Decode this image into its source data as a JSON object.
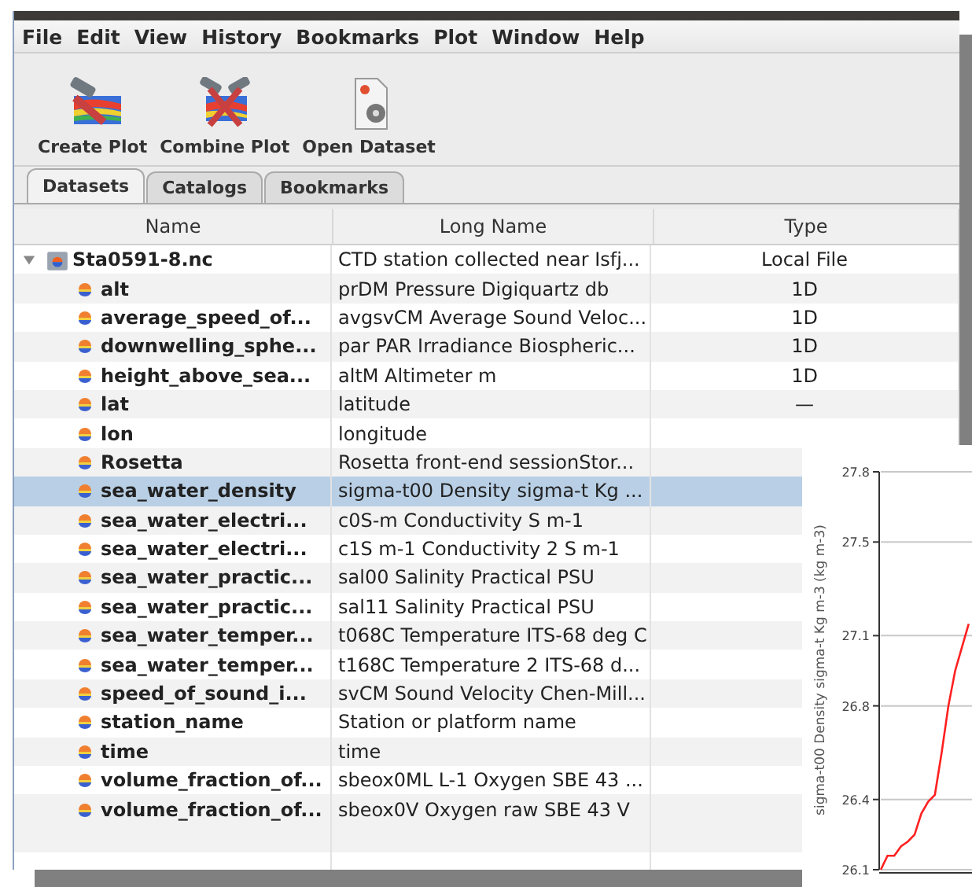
{
  "menu": [
    "File",
    "Edit",
    "View",
    "History",
    "Bookmarks",
    "Plot",
    "Window",
    "Help"
  ],
  "toolbar": [
    {
      "label": "Create Plot",
      "kind": "create"
    },
    {
      "label": "Combine Plot",
      "kind": "combine"
    },
    {
      "label": "Open Dataset",
      "kind": "open"
    }
  ],
  "tabs": [
    {
      "label": "Datasets",
      "selected": true
    },
    {
      "label": "Catalogs",
      "selected": false
    },
    {
      "label": "Bookmarks",
      "selected": false
    }
  ],
  "table": {
    "columns": [
      "Name",
      "Long Name",
      "Type"
    ],
    "rows": [
      {
        "name": "Sta0591-8.nc",
        "long_name": "CTD station collected near Isfj...",
        "type": "Local File",
        "expanded": true,
        "children": [
          {
            "name": "alt",
            "long_name": "prDM Pressure Digiquartz db",
            "type": "1D",
            "selected": false
          },
          {
            "name": "average_speed_of...",
            "long_name": "avgsvCM Average Sound Veloc...",
            "type": "1D",
            "selected": false
          },
          {
            "name": "downwelling_sphe...",
            "long_name": "par PAR Irradiance Biospheric...",
            "type": "1D",
            "selected": false
          },
          {
            "name": "height_above_sea...",
            "long_name": "altM Altimeter m",
            "type": "1D",
            "selected": false
          },
          {
            "name": "lat",
            "long_name": "latitude",
            "type": "—",
            "selected": false
          },
          {
            "name": "lon",
            "long_name": "longitude",
            "selected": false
          },
          {
            "name": "Rosetta",
            "long_name": "Rosetta front-end sessionStor...",
            "selected": false
          },
          {
            "name": "sea_water_density",
            "long_name": "sigma-t00 Density sigma-t Kg ...",
            "selected": true
          },
          {
            "name": "sea_water_electri...",
            "long_name": "c0S-m Conductivity S m-1",
            "selected": false
          },
          {
            "name": "sea_water_electri...",
            "long_name": "c1S m-1 Conductivity 2  S m-1",
            "selected": false
          },
          {
            "name": "sea_water_practic...",
            "long_name": "sal00 Salinity  Practical PSU",
            "selected": false
          },
          {
            "name": "sea_water_practic...",
            "long_name": "sal11 Salinity  Practical PSU",
            "selected": false
          },
          {
            "name": "sea_water_temper...",
            "long_name": "t068C Temperature ITS-68 deg C",
            "selected": false
          },
          {
            "name": "sea_water_temper...",
            "long_name": "t168C Temperature 2 ITS-68 d...",
            "selected": false
          },
          {
            "name": "speed_of_sound_i...",
            "long_name": "svCM Sound Velocity Chen-Mill...",
            "selected": false
          },
          {
            "name": "station_name",
            "long_name": "Station or platform name",
            "selected": false
          },
          {
            "name": "time",
            "long_name": "time",
            "selected": false
          },
          {
            "name": "volume_fraction_of...",
            "long_name": "sbeox0ML L-1 Oxygen SBE 43 ...",
            "selected": false
          },
          {
            "name": "volume_fraction_of...",
            "long_name": "sbeox0V Oxygen raw SBE 43 V",
            "selected": false
          }
        ]
      }
    ]
  },
  "plot_window": {
    "chart_data": {
      "type": "line",
      "grid": true,
      "ylabel": "sigma-t00 Density sigma-t Kg m-3 (kg m-3)",
      "ylim": [
        26.1,
        27.8
      ],
      "yticks": [
        {
          "value": 27.8,
          "label": "27.8"
        },
        {
          "value": 27.5,
          "label": "27.5"
        },
        {
          "value": 27.1,
          "label": "27.1"
        },
        {
          "value": 26.8,
          "label": "26.8"
        },
        {
          "value": 26.4,
          "label": "26.4"
        },
        {
          "value": 26.1,
          "label": "26.1"
        }
      ],
      "series": [
        {
          "color": "#ff2020",
          "values": [
            26.1,
            26.16,
            26.16,
            26.2,
            26.22,
            26.25,
            26.34,
            26.39,
            26.42,
            26.6,
            26.8,
            26.95,
            27.05,
            27.15
          ]
        }
      ]
    }
  }
}
